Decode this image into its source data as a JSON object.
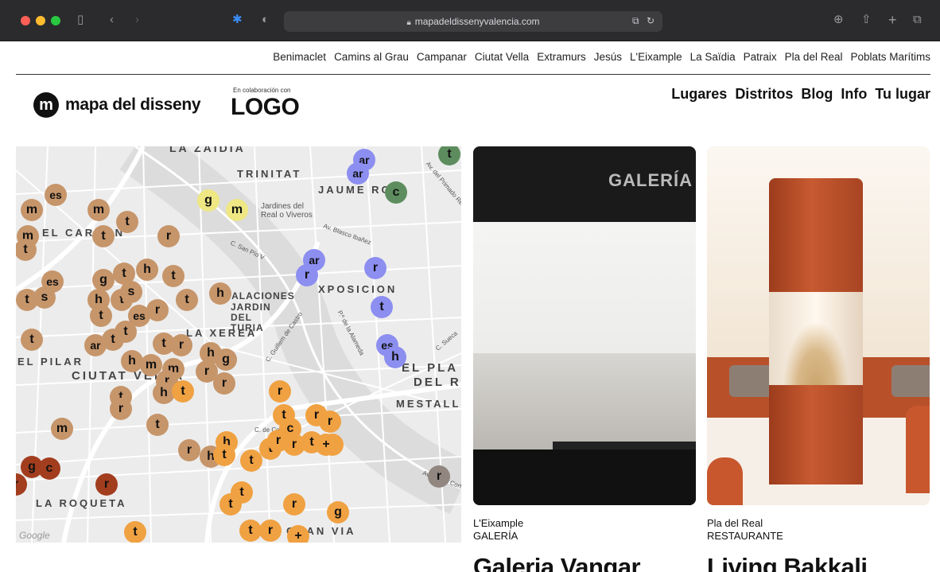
{
  "browser": {
    "url": "mapadeldissenyvalencia.com"
  },
  "districts": [
    "Benimaclet",
    "Camins al Grau",
    "Campanar",
    "Ciutat Vella",
    "Extramurs",
    "Jesús",
    "L'Eixample",
    "La Saïdia",
    "Patraix",
    "Pla del Real",
    "Poblats Marítims"
  ],
  "brand": {
    "mark": "m",
    "name": "mapa del disseny",
    "collab_label": "En colaboración con",
    "collab_logo": "LOGO"
  },
  "main_nav": [
    "Lugares",
    "Distritos",
    "Blog",
    "Info",
    "Tu lugar"
  ],
  "map": {
    "area_labels": [
      "LA ZAIDIA",
      "TRINITAT",
      "JAUME ROIG",
      "EL CARMEN",
      "PALACIONES",
      "JARDIN DEL TURIA",
      "XPOSICION",
      "LA XEREA",
      "EL PILAR",
      "CIUTAT VELLA",
      "EL PLA",
      "DEL R",
      "MESTALL",
      "LA ROQUETA",
      "GRAN VIA"
    ],
    "street_labels": [
      "Jardines del",
      "Real o Viveros",
      "Av. Blasco Ibañez",
      "C. San Pío V",
      "Av. del Primado Re",
      "P.º de la Alameda",
      "C. de Colón",
      "C. Sueca",
      "C. Guillem de Castro",
      "Av. de les Corts"
    ],
    "attribution": "Google",
    "pin_colors": {
      "brown": "#c6956a",
      "orange": "#f0a142",
      "purple": "#8c8ef0",
      "green": "#5d8d5e",
      "yellow": "#eee784",
      "darkred": "#a23d1e",
      "grey": "#918680"
    }
  },
  "cards": [
    {
      "district": "L'Eixample",
      "category": "GALERÍA",
      "title": "Galeria Vangar",
      "sign": "GALERÍA"
    },
    {
      "district": "Pla del Real",
      "category": "RESTAURANTE",
      "title": "Living Bakkali"
    }
  ]
}
